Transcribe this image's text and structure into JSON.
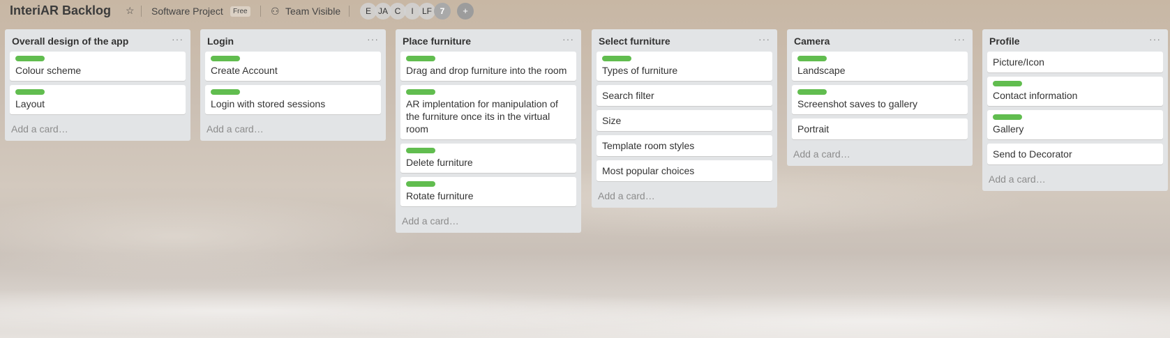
{
  "board": {
    "title": "InteriAR Backlog",
    "team": "Software Project",
    "plan": "Free",
    "visibility": "Team Visible",
    "members": [
      "E",
      "JA",
      "C",
      "I",
      "LF",
      "7"
    ]
  },
  "add_card_label": "Add a card…",
  "lists": [
    {
      "title": "Overall design of the app",
      "cards": [
        {
          "text": "Colour scheme",
          "label": true
        },
        {
          "text": "Layout",
          "label": true
        }
      ]
    },
    {
      "title": "Login",
      "cards": [
        {
          "text": "Create Account",
          "label": true
        },
        {
          "text": "Login with stored sessions",
          "label": true
        }
      ]
    },
    {
      "title": "Place furniture",
      "cards": [
        {
          "text": "Drag and drop furniture into the room",
          "label": true
        },
        {
          "text": "AR implentation for manipulation of the furniture once its in the virtual room",
          "label": true
        },
        {
          "text": "Delete furniture",
          "label": true
        },
        {
          "text": "Rotate furniture",
          "label": true
        }
      ]
    },
    {
      "title": "Select furniture",
      "cards": [
        {
          "text": "Types of furniture",
          "label": true
        },
        {
          "text": "Search filter",
          "label": false
        },
        {
          "text": "Size",
          "label": false
        },
        {
          "text": "Template room styles",
          "label": false
        },
        {
          "text": "Most popular choices",
          "label": false
        }
      ]
    },
    {
      "title": "Camera",
      "cards": [
        {
          "text": "Landscape",
          "label": true
        },
        {
          "text": "Screenshot saves to gallery",
          "label": true
        },
        {
          "text": "Portrait",
          "label": false
        }
      ]
    },
    {
      "title": "Profile",
      "cards": [
        {
          "text": "Picture/Icon",
          "label": false
        },
        {
          "text": "Contact information",
          "label": true
        },
        {
          "text": "Gallery",
          "label": true
        },
        {
          "text": "Send to Decorator",
          "label": false
        }
      ]
    }
  ],
  "colors": {
    "label_green": "#61bd4f",
    "list_bg": "#e2e4e6"
  },
  "icons": {
    "star": "star-icon",
    "visibility": "team-icon",
    "invite": "add-member-icon"
  }
}
